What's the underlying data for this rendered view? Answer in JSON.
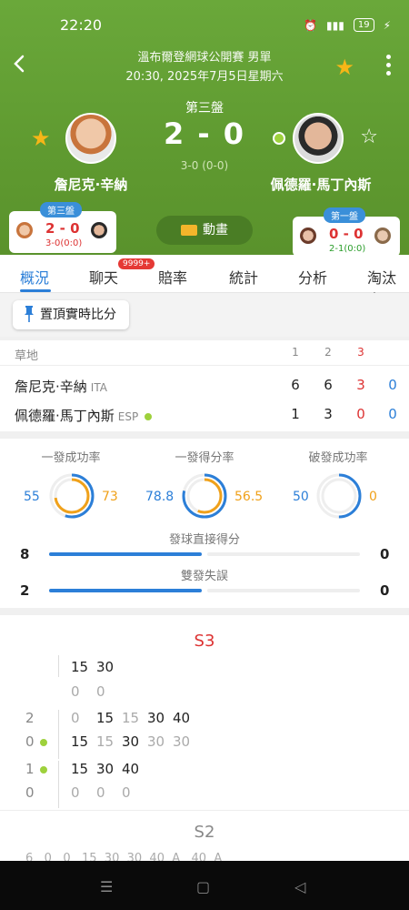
{
  "status_bar": {
    "time": "22:20",
    "battery": "19"
  },
  "header": {
    "tournament": "溫布爾登網球公開賽 男單",
    "datetime": "20:30, 2025年7月5日星期六",
    "current_set": "第三盤",
    "score": "2 - 0",
    "game_score": "3-0 (0-0)",
    "player1": "詹尼克·辛納",
    "player2": "佩德羅·馬丁內斯",
    "animation_label": "動畫"
  },
  "mini_left": {
    "tag": "第三盤",
    "score": "2 - 0",
    "sub": "3-0(0:0)"
  },
  "mini_right": {
    "tag": "第一盤",
    "score": "0 - 0",
    "sub": "2-1(0:0)"
  },
  "tabs": [
    "概況",
    "聊天",
    "賠率",
    "統計",
    "分析",
    "淘汰賽"
  ],
  "chat_badge": "9999+",
  "pin_button": "置頂實時比分",
  "score_table": {
    "surface": "草地",
    "headers": [
      "1",
      "2",
      "3"
    ],
    "rows": [
      {
        "name": "詹尼克·辛納",
        "country": "ITA",
        "sets": [
          "6",
          "6",
          "3"
        ],
        "current": "0"
      },
      {
        "name": "佩德羅·馬丁內斯",
        "country": "ESP",
        "sets": [
          "1",
          "3",
          "0"
        ],
        "current": "0"
      }
    ]
  },
  "stats": {
    "first_serve": {
      "label": "一發成功率",
      "left": "55",
      "right": "73",
      "left_pct": 55,
      "right_pct": 73
    },
    "first_serve_points": {
      "label": "一發得分率",
      "left": "78.8",
      "right": "56.5",
      "left_pct": 78.8,
      "right_pct": 56.5
    },
    "break_points": {
      "label": "破發成功率",
      "left": "50",
      "right": "0",
      "left_pct": 50,
      "right_pct": 0
    },
    "aces": {
      "label": "發球直接得分",
      "left": "8",
      "right": "0",
      "left_frac": 1.0,
      "right_frac": 0
    },
    "double_faults": {
      "label": "雙發失誤",
      "left": "2",
      "right": "0",
      "left_frac": 1.0,
      "right_frac": 0
    }
  },
  "point_by_point": {
    "set3_label": "S3",
    "set2_label": "S2",
    "game1": {
      "top": [
        "15",
        "30"
      ],
      "bottom": [
        "0",
        "0"
      ]
    },
    "game2": {
      "score_top": "2",
      "score_bottom": "0",
      "top": [
        "0",
        "15",
        "15",
        "30",
        "40"
      ],
      "bottom": [
        "15",
        "15",
        "30",
        "30",
        "30"
      ]
    },
    "game3": {
      "score_top": "1",
      "score_bottom": "0",
      "top": [
        "15",
        "30",
        "40"
      ],
      "bottom": [
        "0",
        "0",
        "0"
      ]
    },
    "partial_row": "6   0   0   15  30  30  40  A   40  A"
  },
  "colors": {
    "header_green": "#62a233",
    "accent_blue": "#2c7fd8",
    "star_yellow": "#f6b617",
    "red": "#dd3333"
  }
}
